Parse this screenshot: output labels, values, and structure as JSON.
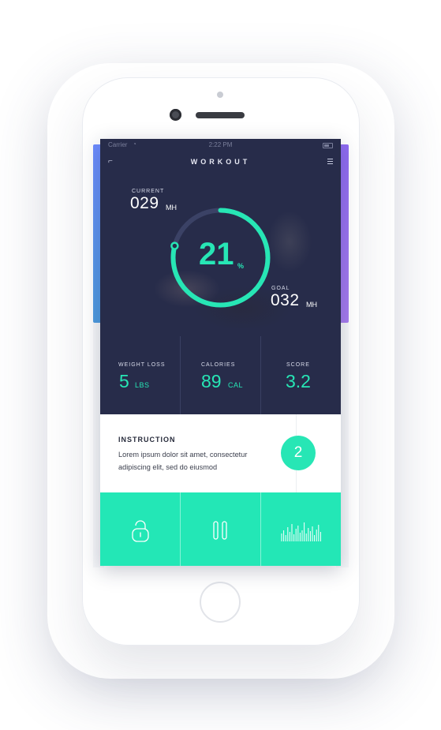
{
  "status_bar": {
    "carrier": "Carrier",
    "time": "2:22 PM"
  },
  "nav": {
    "title": "WORKOUT",
    "back_icon": "back-arrow-icon",
    "menu_icon": "menu-icon"
  },
  "current": {
    "label": "CURRENT",
    "value": "029",
    "unit": "MH"
  },
  "goal": {
    "label": "GOAL",
    "value": "032",
    "unit": "MH"
  },
  "progress": {
    "value": "21",
    "unit": "%",
    "fraction": 0.79
  },
  "stats": [
    {
      "label": "WEIGHT LOSS",
      "value": "5",
      "unit": "LBS"
    },
    {
      "label": "CALORIES",
      "value": "89",
      "unit": "CAL"
    },
    {
      "label": "SCORE",
      "value": "3.2",
      "unit": ""
    }
  ],
  "instruction": {
    "title": "INSTRUCTION",
    "text": "Lorem ipsum dolor sit amet, consectetur adipiscing elit, sed do eiusmod",
    "step": "2"
  },
  "actions": [
    {
      "icon": "lock-icon"
    },
    {
      "icon": "pause-icon"
    },
    {
      "icon": "equalizer-icon"
    }
  ],
  "colors": {
    "accent": "#27e6b5",
    "dark": "#272c4a"
  }
}
